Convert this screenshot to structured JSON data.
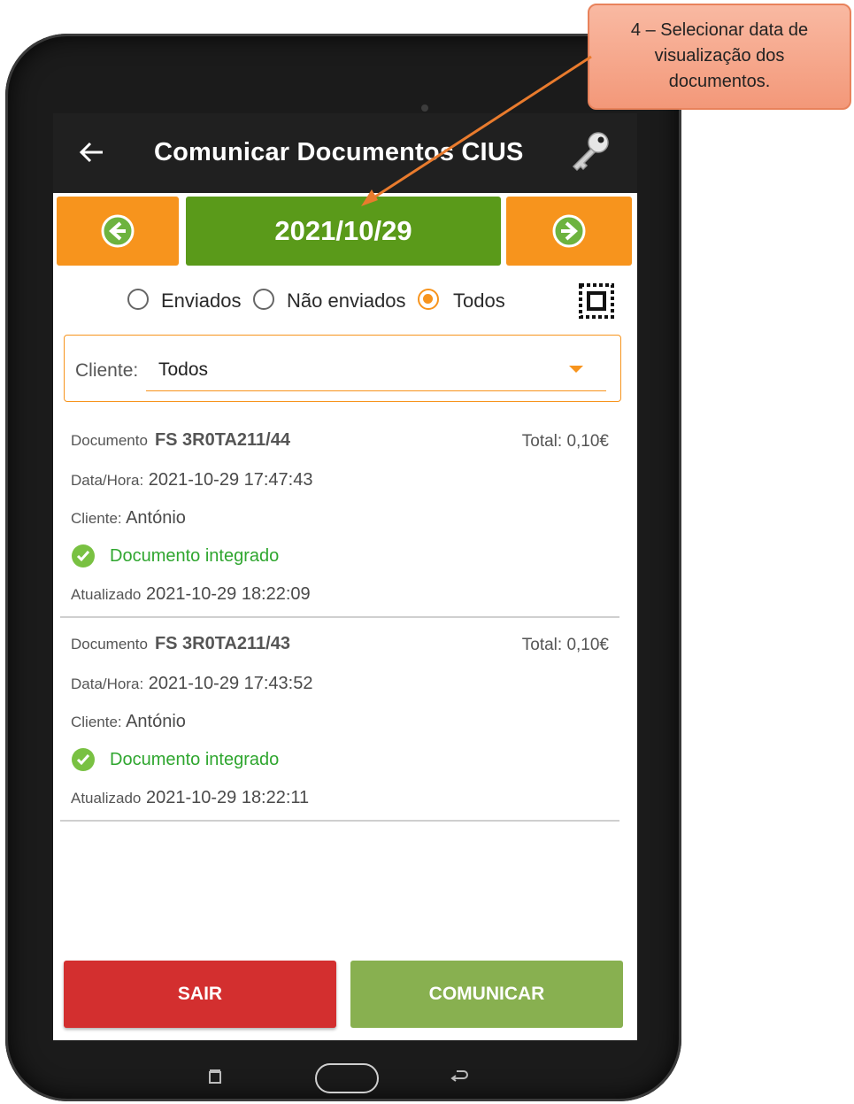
{
  "annotation": {
    "callout_line1": "4 – Selecionar data de",
    "callout_line2": "visualização dos",
    "callout_line3": "documentos.",
    "color": "#f39879"
  },
  "header": {
    "title": "Comunicar Documentos CIUS",
    "back_icon": "arrow-left-icon",
    "key_icon": "key-icon"
  },
  "date_nav": {
    "date": "2021/10/29",
    "prev_icon": "circle-arrow-left-icon",
    "next_icon": "circle-arrow-right-icon",
    "accent": "#f7941d",
    "date_color": "#5a9a1a"
  },
  "filters": {
    "options": [
      "Enviados",
      "Não enviados",
      "Todos"
    ],
    "selected": "Todos"
  },
  "client_filter": {
    "label": "Cliente:",
    "value": "Todos"
  },
  "documents": [
    {
      "doc_label": "Documento",
      "doc_number": "FS 3R0TA211/44",
      "total_label": "Total:",
      "total": "0,10€",
      "datetime_label": "Data/Hora:",
      "datetime": "2021-10-29 17:47:43",
      "client_label": "Cliente:",
      "client": "António",
      "status": "Documento integrado",
      "updated_label": "Atualizado",
      "updated": "2021-10-29 18:22:09"
    },
    {
      "doc_label": "Documento",
      "doc_number": "FS 3R0TA211/43",
      "total_label": "Total:",
      "total": "0,10€",
      "datetime_label": "Data/Hora:",
      "datetime": "2021-10-29 17:43:52",
      "client_label": "Cliente:",
      "client": "António",
      "status": "Documento integrado",
      "updated_label": "Atualizado",
      "updated": "2021-10-29 18:22:11"
    }
  ],
  "actions": {
    "exit_label": "SAIR",
    "send_label": "COMUNICAR",
    "exit_color": "#d32f2f",
    "send_color": "#88b050"
  }
}
